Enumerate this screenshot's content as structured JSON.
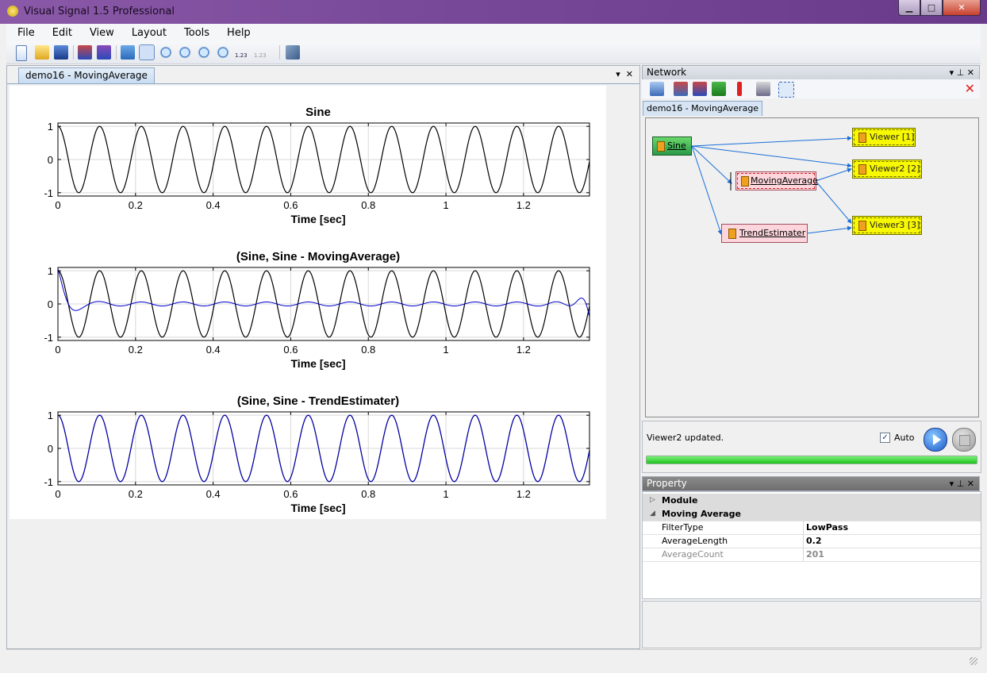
{
  "window": {
    "title": "Visual Signal 1.5 Professional",
    "min_glyph": "▁",
    "max_glyph": "□",
    "close_glyph": "✕"
  },
  "menu": [
    "File",
    "Edit",
    "View",
    "Layout",
    "Tools",
    "Help"
  ],
  "toolbar": {
    "icons": [
      "new-document-icon",
      "open-folder-icon",
      "save-icon",
      "signal-view-icon",
      "signal-copy-icon",
      "home-icon",
      "zoom-in-icon",
      "zoom-out-icon",
      "zoom-fit-icon",
      "zoom-area-icon",
      "zoom-point-icon",
      "axis-scale-icon",
      "axis-scale-disabled-icon",
      "tools-icon"
    ],
    "axis_label": "1.23"
  },
  "document": {
    "tab_label": "demo16 - MovingAverage",
    "dropdown_glyph": "▾",
    "close_glyph": "✕"
  },
  "plots": [
    {
      "title": "Sine",
      "xlabel": "Time [sec]",
      "xticks": [
        "0",
        "0.2",
        "0.4",
        "0.6",
        "0.8",
        "1",
        "1.2"
      ],
      "yticks": [
        "1",
        "0",
        "-1"
      ]
    },
    {
      "title": "(Sine, Sine - MovingAverage)",
      "xlabel": "Time [sec]",
      "xticks": [
        "0",
        "0.2",
        "0.4",
        "0.6",
        "0.8",
        "1",
        "1.2"
      ],
      "yticks": [
        "1",
        "0",
        "-1"
      ]
    },
    {
      "title": "(Sine, Sine - TrendEstimater)",
      "xlabel": "Time [sec]",
      "xticks": [
        "0",
        "0.2",
        "0.4",
        "0.6",
        "0.8",
        "1",
        "1.2"
      ],
      "yticks": [
        "1",
        "0",
        "-1"
      ]
    }
  ],
  "network": {
    "title": "Network",
    "tab_label": "demo16 - MovingAverage",
    "header_glyphs": "▾ ⊥ ✕",
    "toolbar_icons": [
      "add-module-icon",
      "copy-module-icon",
      "signal-module-icon",
      "excel-export-icon",
      "alert-icon",
      "clone-icon",
      "select-area-icon"
    ],
    "delete_glyph": "✕",
    "nodes": {
      "sine": "Sine",
      "moving_average": "MovingAverage",
      "trend": "TrendEstimater",
      "viewer1": "Viewer [1]",
      "viewer2": "Viewer2 [2]",
      "viewer3": "Viewer3 [3]"
    }
  },
  "status": {
    "message": "Viewer2 updated.",
    "auto_label": "Auto",
    "auto_checked": true,
    "progress": 1.0
  },
  "property": {
    "title": "Property",
    "header_glyphs": "▾ ⊥ ✕",
    "categories": [
      {
        "name": "Module",
        "expanded": false,
        "glyph": "▷"
      },
      {
        "name": "Moving Average",
        "expanded": true,
        "glyph": "◢"
      }
    ],
    "rows": [
      {
        "key": "FilterType",
        "value": "LowPass",
        "enabled": true
      },
      {
        "key": "AverageLength",
        "value": "0.2",
        "enabled": true
      },
      {
        "key": "AverageCount",
        "value": "201",
        "enabled": false
      }
    ]
  },
  "colors": {
    "signal": "#000000",
    "filtered": "#0000cc",
    "accent": "#1a6fd8",
    "progress": "#22cc22"
  },
  "chart_data": [
    {
      "type": "line",
      "title": "Sine",
      "xlabel": "Time [sec]",
      "ylabel": "",
      "xlim": [
        0,
        1.37
      ],
      "ylim": [
        -1.1,
        1.1
      ],
      "grid": true,
      "series": [
        {
          "function": "cos",
          "frequency_hz": 9.3,
          "amplitude": 1
        }
      ]
    },
    {
      "type": "line",
      "title": "(Sine, Sine - MovingAverage)",
      "xlabel": "Time [sec]",
      "ylabel": "",
      "xlim": [
        0,
        1.37
      ],
      "ylim": [
        -1.1,
        1.1
      ],
      "grid": true,
      "series": [
        {
          "function": "cos",
          "frequency_hz": 9.3,
          "amplitude": 1
        },
        {
          "function": "cos-residual",
          "frequency_hz": 9.3,
          "amplitude": 0.06
        }
      ]
    },
    {
      "type": "line",
      "title": "(Sine, Sine - TrendEstimater)",
      "xlabel": "Time [sec]",
      "ylabel": "",
      "xlim": [
        0,
        1.37
      ],
      "ylim": [
        -1.1,
        1.1
      ],
      "grid": true,
      "series": [
        {
          "function": "cos",
          "frequency_hz": 9.3,
          "amplitude": 1
        },
        {
          "function": "cos",
          "frequency_hz": 9.3,
          "amplitude": 1
        }
      ]
    }
  ]
}
